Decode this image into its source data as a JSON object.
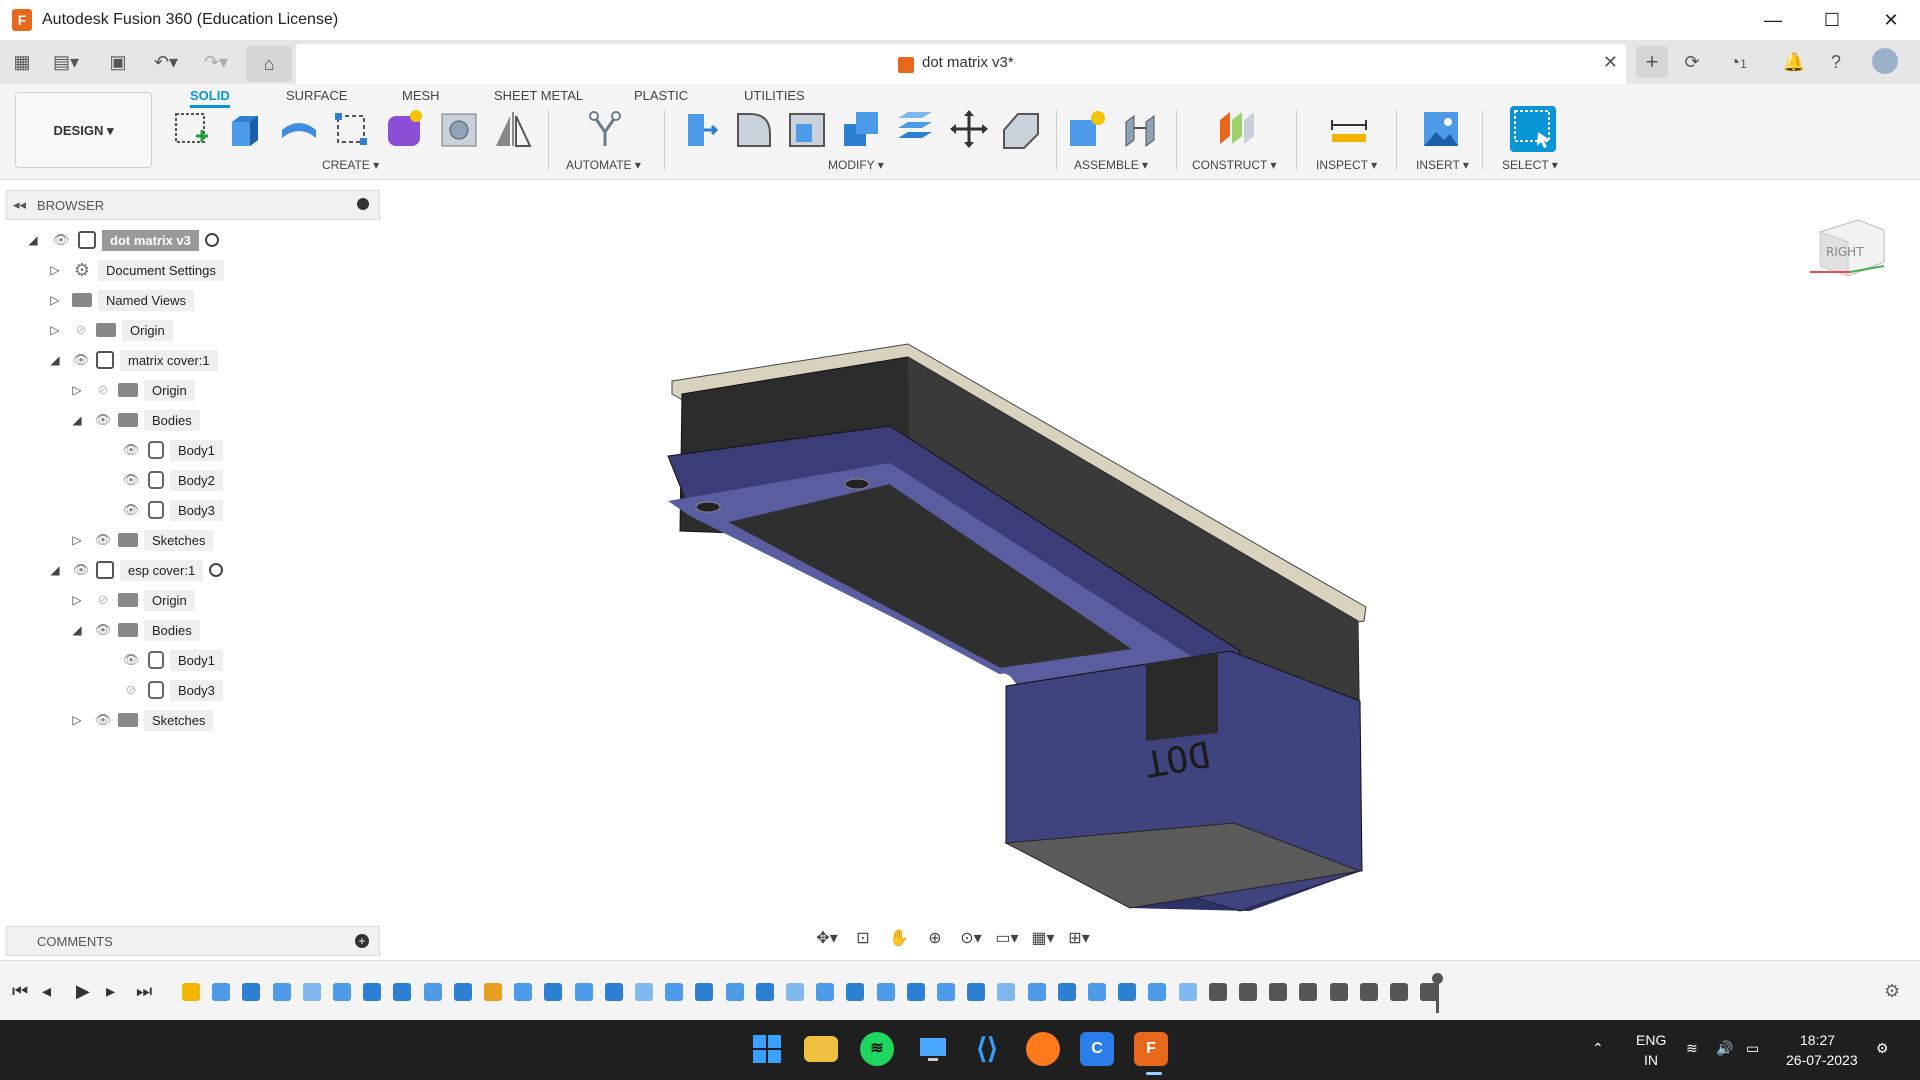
{
  "window": {
    "title": "Autodesk Fusion 360 (Education License)",
    "app_icon": "F",
    "minimize": "—",
    "maximize": "☐",
    "close": "✕"
  },
  "tabbar": {
    "document_title": "dot matrix v3*",
    "close": "✕",
    "new_tab": "+",
    "jobs_count": "1"
  },
  "ribbon": {
    "workspace": "DESIGN",
    "tabs": [
      "SOLID",
      "SURFACE",
      "MESH",
      "SHEET METAL",
      "PLASTIC",
      "UTILITIES"
    ],
    "active_tab": "SOLID",
    "groups": [
      "CREATE",
      "AUTOMATE",
      "MODIFY",
      "ASSEMBLE",
      "CONSTRUCT",
      "INSPECT",
      "INSERT",
      "SELECT"
    ],
    "accent": "#0696d7"
  },
  "browser": {
    "title": "BROWSER",
    "root": "dot matrix v3",
    "items": {
      "document_settings": "Document Settings",
      "named_views": "Named Views",
      "origin": "Origin",
      "matrix_cover": "matrix cover:1",
      "bodies": "Bodies",
      "body1": "Body1",
      "body2": "Body2",
      "body3": "Body3",
      "sketches": "Sketches",
      "esp_cover": "esp cover:1"
    }
  },
  "comments": {
    "title": "COMMENTS"
  },
  "viewcube": {
    "face": "RIGHT"
  },
  "taskbar": {
    "language_line1": "ENG",
    "language_line2": "IN",
    "time": "18:27",
    "date": "26-07-2023"
  }
}
